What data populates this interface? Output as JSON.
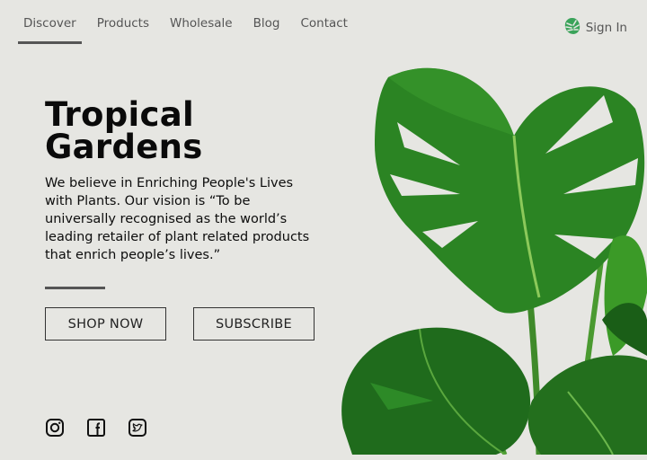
{
  "nav": {
    "items": [
      {
        "label": "Discover",
        "active": true
      },
      {
        "label": "Products",
        "active": false
      },
      {
        "label": "Wholesale",
        "active": false
      },
      {
        "label": "Blog",
        "active": false
      },
      {
        "label": "Contact",
        "active": false
      }
    ],
    "signin": {
      "label": "Sign In",
      "icon": "monstera-leaf-icon"
    }
  },
  "hero": {
    "title_line1": "Tropical",
    "title_line2": "Gardens",
    "description": "We believe in Enriching People's Lives with Plants.  Our vision is “To be universally recognised as the world’s leading retailer of plant related products that enrich people’s lives.”",
    "shop_button": "SHOP NOW",
    "subscribe_button": "SUBSCRIBE"
  },
  "social": [
    {
      "icon": "instagram-icon"
    },
    {
      "icon": "facebook-icon"
    },
    {
      "icon": "twitter-icon"
    }
  ],
  "colors": {
    "background": "#e6e6e2",
    "leaf_dark": "#1f6b1c",
    "leaf_mid": "#2f8a26",
    "accent_green": "#3aa35a"
  }
}
